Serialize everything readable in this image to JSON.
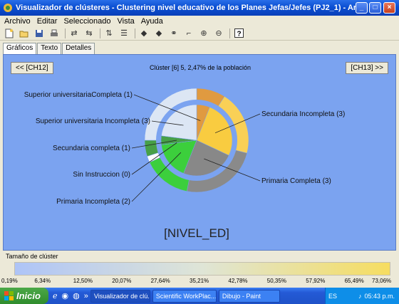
{
  "window": {
    "title": "Visualizador de clústeres - Clustering nivel educativo de los Planes Jefas/Jefes (PJ2_1) - Archivo local: general I...",
    "buttons": [
      "_",
      "□",
      "×"
    ]
  },
  "menu": [
    "Archivo",
    "Editar",
    "Seleccionado",
    "Vista",
    "Ayuda"
  ],
  "tabs": [
    "Gráficos",
    "Texto",
    "Detalles"
  ],
  "nav": {
    "prev": "<< [CH12]",
    "next": "[CH13] >>"
  },
  "cluster_info": "Clúster [6] 5, 2,47% de la población",
  "chart_data": {
    "type": "pie",
    "title": "[NIVEL_ED]",
    "inner_ring": {
      "categories": [
        "Superior universitariaCompleta",
        "Secundaria Incompleta",
        "Primaria Completa",
        "Primaria Incompleta",
        "Sin Instruccion",
        "Secundaria completa",
        "Superior universitaria Incompleta"
      ],
      "codes": [
        1,
        3,
        3,
        2,
        0,
        1,
        3
      ],
      "values": [
        6,
        26,
        24,
        17,
        0,
        4,
        23
      ],
      "colors": [
        "#e09a40",
        "#f9cc40",
        "#888888",
        "#3ccf3c",
        "#ffffff",
        "#47a047",
        "#dce6f4"
      ]
    },
    "outer_ring": {
      "categories": [
        "Superior universitariaCompleta",
        "Secundaria Incompleta",
        "Primaria Completa",
        "Primaria Incompleta",
        "Sin Instruccion",
        "Secundaria completa",
        "Superior universitaria Incompleta"
      ],
      "values": [
        9,
        20,
        24,
        15,
        2,
        5,
        25
      ],
      "colors": [
        "#e09a40",
        "#f9d056",
        "#8a8a8a",
        "#3ccf3c",
        "#ffffff",
        "#47a047",
        "#dce6f4"
      ]
    },
    "labels": [
      "Superior universitariaCompleta (1)",
      "Superior universitaria Incompleta (3)",
      "Secundaria completa (1)",
      "Sin Instruccion (0)",
      "Primaria Incompleta (2)",
      "Secundaria Incompleta (3)",
      "Primaria Completa (3)"
    ]
  },
  "size_legend": {
    "label": "Tamaño de clúster",
    "ticks": [
      "0,19%",
      "6,34%",
      "12,50%",
      "20,07%",
      "27,64%",
      "35,21%",
      "42,78%",
      "50,35%",
      "57,92%",
      "65,49%",
      "73,06%"
    ]
  },
  "taskbar": {
    "start": "Inicio",
    "tasks": [
      "Visualizador de clú...",
      "Scientific WorkPlac...",
      "Dibujo - Paint"
    ],
    "tray": {
      "lang": "ES",
      "time": "05:43 p.m."
    }
  }
}
